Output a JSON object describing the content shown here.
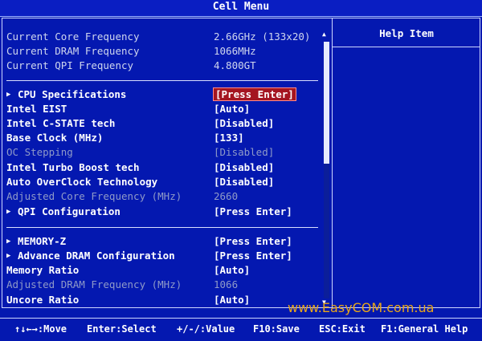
{
  "header": {
    "title": "Cell Menu"
  },
  "info": [
    {
      "label": "Current Core Frequency",
      "value": "2.66GHz (133x20)"
    },
    {
      "label": "Current DRAM Frequency",
      "value": "1066MHz"
    },
    {
      "label": "Current QPI Frequency",
      "value": "4.800GT"
    }
  ],
  "items": [
    {
      "label": "CPU Specifications",
      "value": "[Press Enter]"
    },
    {
      "label": "Intel EIST",
      "value": "[Auto]"
    },
    {
      "label": "Intel C-STATE tech",
      "value": "[Disabled]"
    },
    {
      "label": "Base Clock (MHz)",
      "value": "[133]"
    },
    {
      "label": "OC Stepping",
      "value": "[Disabled]"
    },
    {
      "label": "Intel Turbo Boost tech",
      "value": "[Disabled]"
    },
    {
      "label": "Auto OverClock Technology",
      "value": "[Disabled]"
    },
    {
      "label": "Adjusted Core Frequency (MHz)",
      "value": "2660"
    },
    {
      "label": "QPI Configuration",
      "value": "[Press Enter]"
    },
    {
      "label": "MEMORY-Z",
      "value": "[Press Enter]"
    },
    {
      "label": "Advance DRAM Configuration",
      "value": "[Press Enter]"
    },
    {
      "label": "Memory Ratio",
      "value": "[Auto]"
    },
    {
      "label": "Adjusted DRAM Frequency (MHz)",
      "value": "1066"
    },
    {
      "label": "Uncore Ratio",
      "value": "[Auto]"
    }
  ],
  "help": {
    "title": "Help Item"
  },
  "watermark": "www.EasyCOM.com.ua",
  "footer": {
    "move": "↑↓←→:Move",
    "select": "Enter:Select",
    "value": "+/-/:Value",
    "save": "F10:Save",
    "exit": "ESC:Exit",
    "help": "F1:General Help"
  },
  "colors": {
    "background": "#0418b0",
    "selected": "#a41520",
    "watermark": "#e8a61a"
  }
}
